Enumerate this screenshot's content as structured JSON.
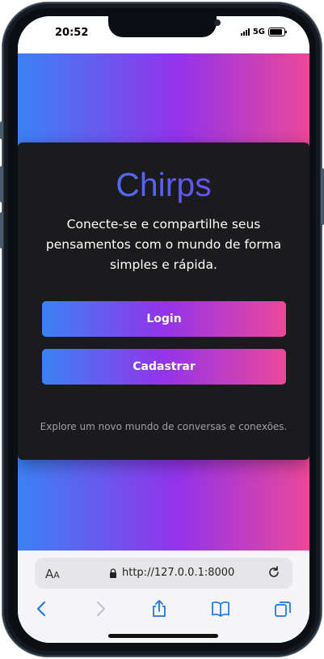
{
  "status_bar": {
    "time": "20:52",
    "network": "5G"
  },
  "app": {
    "title": "Chirps",
    "tagline": "Conecte-se e compartilhe seus pensamentos com o mundo de forma simples e rápida.",
    "login_label": "Login",
    "signup_label": "Cadastrar",
    "footer": "Explore um novo mundo de conversas e conexões."
  },
  "browser": {
    "text_size_label_big": "A",
    "text_size_label_small": "A",
    "url": "http://127.0.0.1:8000"
  },
  "colors": {
    "gradient_start": "#3b82f6",
    "gradient_mid": "#9333ea",
    "gradient_end": "#ec4899",
    "card_bg": "#1b1b1e",
    "safari_blue": "#1a73e8"
  },
  "icons": [
    "lock-icon",
    "reload-icon",
    "back-icon",
    "forward-icon",
    "share-icon",
    "bookmarks-icon",
    "tabs-icon"
  ]
}
